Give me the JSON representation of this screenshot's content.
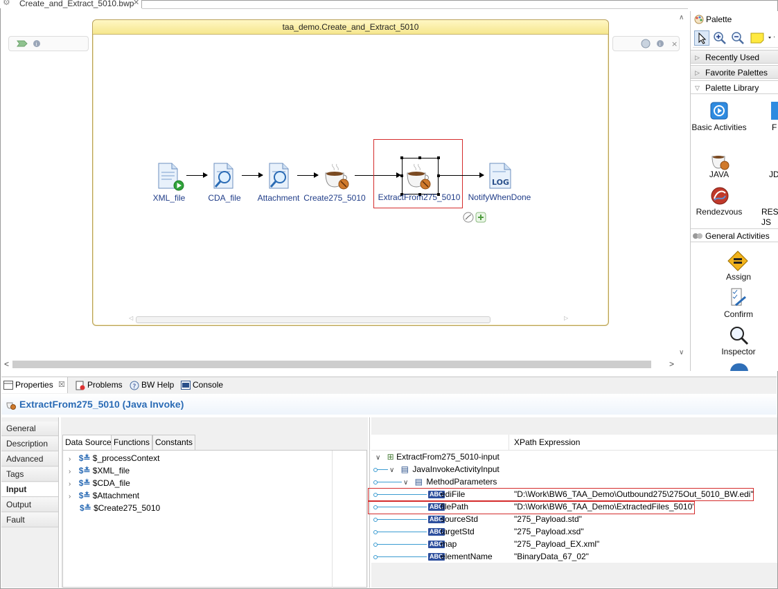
{
  "editor": {
    "tab_label": "Create_and_Extract_5010.bwp",
    "process_title": "taa_demo.Create_and_Extract_5010"
  },
  "process": {
    "nodes": [
      {
        "label": "XML_file",
        "icon": "xml-file-start-icon"
      },
      {
        "label": "CDA_file",
        "icon": "parse-search-icon"
      },
      {
        "label": "Attachment",
        "icon": "parse-search-icon"
      },
      {
        "label": "Create275_5010",
        "icon": "java-coffee-icon"
      },
      {
        "label": "ExtractFrom275_5010",
        "icon": "java-coffee-icon"
      },
      {
        "label": "NotifyWhenDone",
        "icon": "log-icon"
      }
    ]
  },
  "palette": {
    "title": "Palette",
    "recently_used": "Recently Used",
    "favorite_palettes": "Favorite Palettes",
    "palette_library": "Palette Library",
    "library_items": [
      "Basic Activities",
      "JAVA",
      "Rendezvous"
    ],
    "library_items_clipped": [
      "F",
      "JD",
      "REST JS"
    ],
    "general_activities": "General Activities",
    "general_items": [
      "Assign",
      "Confirm",
      "Inspector"
    ]
  },
  "bottom_tabs": {
    "properties": "Properties",
    "problems": "Problems",
    "bw_help": "BW Help",
    "console": "Console"
  },
  "properties": {
    "title": "ExtractFrom275_5010 (Java Invoke)",
    "side_tabs": [
      "General",
      "Description",
      "Advanced",
      "Tags",
      "Input",
      "Output",
      "Fault"
    ],
    "active_side_tab": "Input",
    "data_tabs": [
      "Data Source",
      "Functions",
      "Constants"
    ],
    "data_source": [
      "$_processContext",
      "$XML_file",
      "$CDA_file",
      "$Attachment",
      "$Create275_5010"
    ],
    "xpath_header": "XPath Expression",
    "tree": {
      "root": "ExtractFrom275_5010-input",
      "input": "JavaInvokeActivityInput",
      "params": "MethodParameters",
      "fields": [
        {
          "name": "ediFile",
          "value": "\"D:\\Work\\BW6_TAA_Demo\\Outbound275\\275Out_5010_BW.edi\""
        },
        {
          "name": "filePath",
          "value": "\"D:\\Work\\BW6_TAA_Demo\\ExtractedFiles_5010\""
        },
        {
          "name": "sourceStd",
          "value": "\"275_Payload.std\""
        },
        {
          "name": "targetStd",
          "value": "\"275_Payload.xsd\""
        },
        {
          "name": "map",
          "value": "\"275_Payload_EX.xml\""
        },
        {
          "name": "elementName",
          "value": "\"BinaryData_67_02\""
        }
      ],
      "abc_badge": "ABC"
    }
  },
  "colors": {
    "process_title_bg": "#f6e78e",
    "label_blue": "#1f3c88",
    "highlight_red": "#d42b2b",
    "prop_title": "#2a6bb5"
  }
}
